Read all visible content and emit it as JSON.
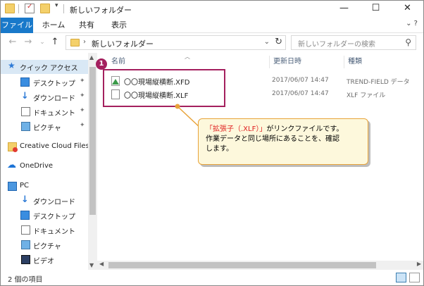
{
  "window": {
    "title": "新しいフォルダー",
    "controls": {
      "minimize": "—",
      "maximize": "☐",
      "close": "✕"
    }
  },
  "ribbon": {
    "tabs": [
      "ファイル",
      "ホーム",
      "共有",
      "表示"
    ],
    "right": "⌄  ?"
  },
  "address": {
    "crumb": "新しいフォルダー",
    "search_placeholder": "新しいフォルダーの検索"
  },
  "nav": {
    "items": [
      {
        "label": "クイック アクセス",
        "icon": "star-icon",
        "pinned": false
      },
      {
        "label": "デスクトップ",
        "icon": "desktop-icon",
        "pinned": true
      },
      {
        "label": "ダウンロード",
        "icon": "download-icon",
        "pinned": true
      },
      {
        "label": "ドキュメント",
        "icon": "documents-icon",
        "pinned": true
      },
      {
        "label": "ピクチャ",
        "icon": "pictures-icon",
        "pinned": true
      },
      {
        "label": "Creative Cloud Files",
        "icon": "creative-cloud-icon",
        "pinned": false
      },
      {
        "label": "OneDrive",
        "icon": "onedrive-icon",
        "pinned": false
      },
      {
        "label": "PC",
        "icon": "pc-icon",
        "pinned": false
      },
      {
        "label": "ダウンロード",
        "icon": "download-icon",
        "pinned": false
      },
      {
        "label": "デスクトップ",
        "icon": "desktop-icon",
        "pinned": false
      },
      {
        "label": "ドキュメント",
        "icon": "documents-icon",
        "pinned": false
      },
      {
        "label": "ピクチャ",
        "icon": "pictures-icon",
        "pinned": false
      },
      {
        "label": "ビデオ",
        "icon": "videos-icon",
        "pinned": false
      }
    ],
    "pin_glyph": "📌"
  },
  "columns": {
    "name": "名前",
    "date": "更新日時",
    "type": "種類"
  },
  "files": [
    {
      "name": "〇〇現場縦横断.XFD",
      "date": "2017/06/07 14:47",
      "type": "TREND-FIELD データ",
      "icon": "trend-field-file-icon"
    },
    {
      "name": "〇〇現場縦横断.XLF",
      "date": "2017/06/07 14:47",
      "type": "XLF ファイル",
      "icon": "blank-file-icon"
    }
  ],
  "status": {
    "count": "2 個の項目"
  },
  "annotation": {
    "badge": "1",
    "callout_red": "「拡張子（.XLF）」",
    "callout_rest1": "がリンクファイルです。",
    "callout_line2": "作業データと同じ場所にあることを、確認",
    "callout_line3": "します。"
  },
  "colors": {
    "accent": "#1979ca",
    "highlight": "#a4205e",
    "callout_border": "#e8a33a",
    "callout_bg": "#fdf8dc",
    "callout_red": "#e02020"
  }
}
